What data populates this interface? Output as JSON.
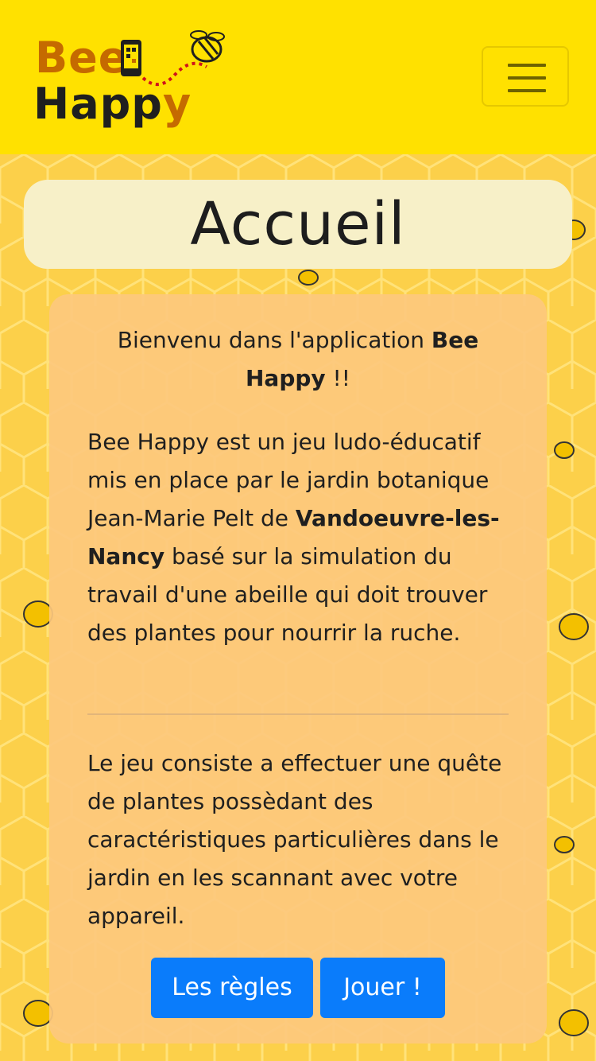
{
  "header": {
    "logo": {
      "word1": "Bee",
      "word2_main": "Happ",
      "word2_tail": "y"
    },
    "menu_toggle_icon": "hamburger-menu-icon"
  },
  "page": {
    "title": "Accueil"
  },
  "content": {
    "welcome_prefix": "Bienvenu dans l'application ",
    "welcome_bold": "Bee Happy",
    "welcome_suffix": " !!",
    "para1_a": "Bee Happy est un jeu ludo-éducatif mis en place par le jardin botanique Jean-Marie Pelt de ",
    "para1_bold": "Vandoeuvre-les-Nancy",
    "para1_b": " basé sur la simulation du travail d'une abeille qui doit trouver des plantes pour nourrir la ruche.",
    "para2": "Le jeu consiste a effectuer une quête de plantes possèdant des caractéristiques particulières dans le jardin en les scannant avec votre appareil."
  },
  "buttons": {
    "rules": "Les règles",
    "play": "Jouer !"
  },
  "colors": {
    "header_bg": "#ffe100",
    "honeycomb_bg": "#fcd04a",
    "title_card_bg": "#f7f0c8",
    "content_card_bg": "#fdc87d",
    "button_bg": "#0a7cfb",
    "logo_orange": "#c56a00"
  }
}
